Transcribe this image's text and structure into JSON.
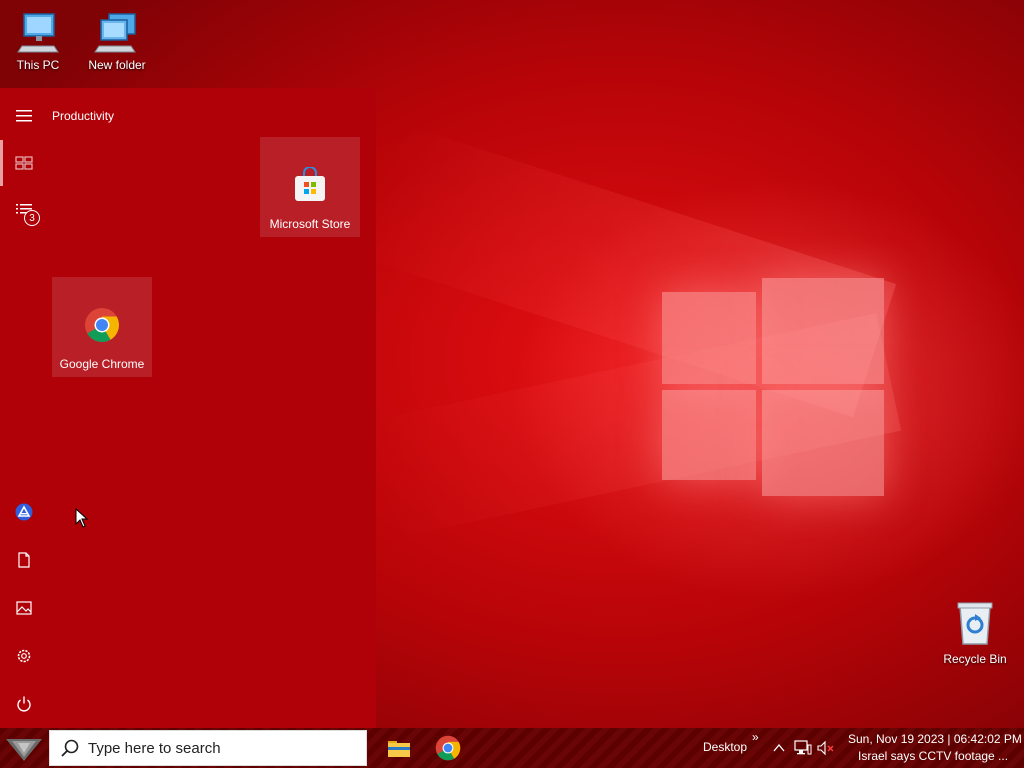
{
  "desktop": {
    "icons": [
      {
        "label": "This PC",
        "icon": "computer-icon"
      },
      {
        "label": "New folder",
        "icon": "network-folder-icon"
      },
      {
        "label": "Recycle Bin",
        "icon": "recycle-bin-icon"
      }
    ]
  },
  "start_menu": {
    "header_label": "Productivity",
    "notification_count": "3",
    "tiles": [
      {
        "label": "Microsoft Store",
        "icon": "store-icon"
      },
      {
        "label": "Google Chrome",
        "icon": "chrome-icon"
      }
    ],
    "rail_icons": [
      "hamburger-icon",
      "tiles-icon",
      "all-apps-icon",
      "account-icon",
      "documents-icon",
      "pictures-icon",
      "settings-icon",
      "power-icon"
    ]
  },
  "taskbar": {
    "search_placeholder": "Type here to search",
    "pinned": [
      "file-explorer-icon",
      "chrome-icon"
    ],
    "desktop_label": "Desktop",
    "overflow_glyph": "»",
    "clock_line1": "Sun, Nov 19 2023 | 06:42:02 PM",
    "clock_line2": "Israel says CCTV footage ..."
  },
  "colors": {
    "start_menu_bg": "#b00008",
    "taskbar_bg": "#5c0000",
    "accent": "#e40f12"
  }
}
